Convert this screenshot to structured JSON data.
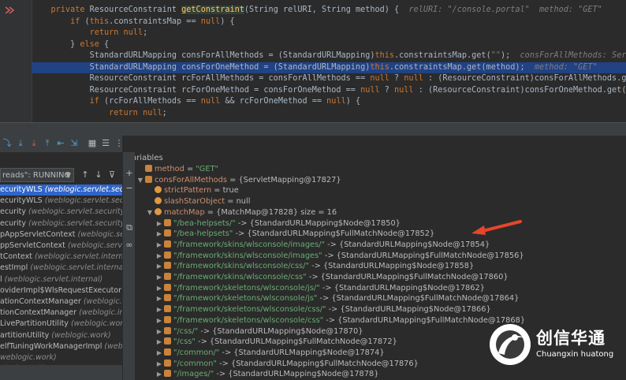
{
  "editor": {
    "lines": [
      {
        "parts": [
          {
            "t": "    private ",
            "c": "k"
          },
          {
            "t": "ResourceConstraint ",
            "c": ""
          },
          {
            "t": "getConstraint",
            "c": "f hl"
          },
          {
            "t": "(String relURI, String method) {  ",
            "c": ""
          },
          {
            "t": "relURI: \"/console.portal\"  method: \"GET\"",
            "c": "hint"
          }
        ]
      },
      {
        "parts": [
          {
            "t": "        ",
            "c": ""
          },
          {
            "t": "if ",
            "c": "k"
          },
          {
            "t": "(",
            "c": ""
          },
          {
            "t": "this",
            "c": "k"
          },
          {
            "t": ".constraintsMap == ",
            "c": ""
          },
          {
            "t": "null",
            "c": "k"
          },
          {
            "t": ") {",
            "c": ""
          }
        ]
      },
      {
        "parts": [
          {
            "t": "            ",
            "c": ""
          },
          {
            "t": "return null",
            "c": "k"
          },
          {
            "t": ";",
            "c": ""
          }
        ]
      },
      {
        "parts": [
          {
            "t": "        } ",
            "c": ""
          },
          {
            "t": "else ",
            "c": "k"
          },
          {
            "t": "{",
            "c": ""
          }
        ]
      },
      {
        "parts": [
          {
            "t": "            StandardURLMapping consForAllMethods = (StandardURLMapping)",
            "c": ""
          },
          {
            "t": "this",
            "c": "k"
          },
          {
            "t": ".constraintsMap.get(",
            "c": ""
          },
          {
            "t": "\"\"",
            "c": "s"
          },
          {
            "t": ");  ",
            "c": ""
          },
          {
            "t": "consForAllMethods: ServletMapping@17827",
            "c": "hint"
          }
        ]
      },
      {
        "parts": [
          {
            "t": "            StandardURLMapping consForOneMethod = (StandardURLMapping)",
            "c": ""
          },
          {
            "t": "this",
            "c": "k"
          },
          {
            "t": ".constraintsMap.get(method);  ",
            "c": ""
          },
          {
            "t": "method: \"GET\"",
            "c": "hint"
          }
        ],
        "selected": true
      },
      {
        "parts": [
          {
            "t": "            ResourceConstraint rcForAllMethods = consForAllMethods == ",
            "c": ""
          },
          {
            "t": "null",
            "c": "k"
          },
          {
            "t": " ? ",
            "c": ""
          },
          {
            "t": "null",
            "c": "k"
          },
          {
            "t": " : (ResourceConstraint)consForAllMethods.get(relURI);",
            "c": ""
          }
        ]
      },
      {
        "parts": [
          {
            "t": "            ResourceConstraint rcForOneMethod = consForOneMethod == ",
            "c": ""
          },
          {
            "t": "null",
            "c": "k"
          },
          {
            "t": " ? ",
            "c": ""
          },
          {
            "t": "null",
            "c": "k"
          },
          {
            "t": " : (ResourceConstraint)consForOneMethod.get(relURI);",
            "c": ""
          }
        ]
      },
      {
        "parts": [
          {
            "t": "            ",
            "c": ""
          },
          {
            "t": "if ",
            "c": "k"
          },
          {
            "t": "(rcForAllMethods == ",
            "c": ""
          },
          {
            "t": "null",
            "c": "k"
          },
          {
            "t": " && rcForOneMethod == ",
            "c": ""
          },
          {
            "t": "null",
            "c": "k"
          },
          {
            "t": ") {",
            "c": ""
          }
        ]
      },
      {
        "parts": [
          {
            "t": "                ",
            "c": ""
          },
          {
            "t": "return null",
            "c": "k"
          },
          {
            "t": ";",
            "c": ""
          }
        ]
      }
    ]
  },
  "toolbar": {
    "icons": [
      "step-over-icon",
      "step-into-icon",
      "force-step-into-icon",
      "step-out-icon",
      "drop-frame-icon",
      "run-to-cursor-icon",
      "evaluate-icon",
      "table-view-icon",
      "settings-icon"
    ],
    "glyphs": [
      "⤵",
      "⤓",
      "⤓",
      "⤒",
      "⇤",
      "⇲",
      "▦",
      "☰",
      "⋮"
    ]
  },
  "frames": {
    "thread_label": "reads\": RUNNING",
    "items": [
      {
        "method": "ecurityWLS ",
        "cls": "(weblogic.servlet.secur",
        "selected": true
      },
      {
        "method": "ecurityWLS ",
        "cls": "(weblogic.servlet.security.i",
        "selected": false
      },
      {
        "method": "ecurity ",
        "cls": "(weblogic.servlet.security.internal)",
        "selected": false
      },
      {
        "method": "ecurity ",
        "cls": "(weblogic.servlet.security.int",
        "selected": false
      },
      {
        "method": "pAppServletContext ",
        "cls": "(weblogic.servlet.i",
        "selected": false
      },
      {
        "method": "ppServletContext ",
        "cls": "(weblogic.servlet.int",
        "selected": false
      },
      {
        "method": "tContext ",
        "cls": "(weblogic.servlet.internal.",
        "selected": false
      },
      {
        "method": "estImpl ",
        "cls": "(weblogic.servlet.internal",
        "selected": false
      },
      {
        "method": "l ",
        "cls": "(weblogic.servlet.internal)",
        "selected": false
      },
      {
        "method": "oviderImpl$WlsRequestExecutor ",
        "cls": "(we",
        "selected": false
      },
      {
        "method": "ationContextManager ",
        "cls": "(weblogic.invo",
        "selected": false
      },
      {
        "method": "tionContextManager ",
        "cls": "(weblogic.invo",
        "selected": false
      },
      {
        "method": "LivePartitionUtility ",
        "cls": "(weblogic.work)",
        "selected": false
      },
      {
        "method": "artitionUtility ",
        "cls": "(weblogic.work)",
        "selected": false
      },
      {
        "method": "elfTuningWorkManagerImpl ",
        "cls": "(weblog",
        "selected": false
      },
      {
        "method": "",
        "cls": "weblogic.work)",
        "selected": false
      },
      {
        "method": "",
        "cls": "ologic.work)",
        "selected": false
      }
    ]
  },
  "variables": {
    "title": "Variables",
    "rows": [
      {
        "indent": 0,
        "tri": "",
        "icon": "ln",
        "name": "method",
        "eq": " = ",
        "val": "\"GET\"",
        "vc": "vstr",
        "meta": ""
      },
      {
        "indent": 0,
        "tri": "▼",
        "icon": "ln",
        "name": "consForAllMethods",
        "eq": " = ",
        "val": "{ServletMapping@17827}",
        "vc": "vobj",
        "meta": ""
      },
      {
        "indent": 1,
        "tri": "",
        "icon": "fo",
        "name": "strictPattern",
        "eq": " = ",
        "val": "true",
        "vc": "vobj",
        "meta": ""
      },
      {
        "indent": 1,
        "tri": "",
        "icon": "fo",
        "name": "slashStarObject",
        "eq": " = ",
        "val": "null",
        "vc": "vobj",
        "meta": ""
      },
      {
        "indent": 1,
        "tri": "▼",
        "icon": "fo",
        "name": "matchMap",
        "eq": " = ",
        "val": "{MatchMap@17828}",
        "vc": "vobj",
        "meta": "  size = 16"
      },
      {
        "indent": 2,
        "tri": "▶",
        "icon": "ln",
        "name": "",
        "eq": "",
        "val": "\"/bea-helpsets/\"",
        "vc": "vstr",
        "meta": " -> {StandardURLMapping$Node@17850}"
      },
      {
        "indent": 2,
        "tri": "▶",
        "icon": "ln",
        "name": "",
        "eq": "",
        "val": "\"/bea-helpsets\"",
        "vc": "vstr",
        "meta": " -> {StandardURLMapping$FullMatchNode@17852}"
      },
      {
        "indent": 2,
        "tri": "▶",
        "icon": "ln",
        "name": "",
        "eq": "",
        "val": "\"/framework/skins/wlsconsole/images/\"",
        "vc": "vstr",
        "meta": " -> {StandardURLMapping$Node@17854}"
      },
      {
        "indent": 2,
        "tri": "▶",
        "icon": "ln",
        "name": "",
        "eq": "",
        "val": "\"/framework/skins/wlsconsole/images\"",
        "vc": "vstr",
        "meta": " -> {StandardURLMapping$FullMatchNode@17856}"
      },
      {
        "indent": 2,
        "tri": "▶",
        "icon": "ln",
        "name": "",
        "eq": "",
        "val": "\"/framework/skins/wlsconsole/css/\"",
        "vc": "vstr",
        "meta": " -> {StandardURLMapping$Node@17858}"
      },
      {
        "indent": 2,
        "tri": "▶",
        "icon": "ln",
        "name": "",
        "eq": "",
        "val": "\"/framework/skins/wlsconsole/css\"",
        "vc": "vstr",
        "meta": " -> {StandardURLMapping$FullMatchNode@17860}"
      },
      {
        "indent": 2,
        "tri": "▶",
        "icon": "ln",
        "name": "",
        "eq": "",
        "val": "\"/framework/skeletons/wlsconsole/js/\"",
        "vc": "vstr",
        "meta": " -> {StandardURLMapping$Node@17862}"
      },
      {
        "indent": 2,
        "tri": "▶",
        "icon": "ln",
        "name": "",
        "eq": "",
        "val": "\"/framework/skeletons/wlsconsole/js\"",
        "vc": "vstr",
        "meta": " -> {StandardURLMapping$FullMatchNode@17864}"
      },
      {
        "indent": 2,
        "tri": "▶",
        "icon": "ln",
        "name": "",
        "eq": "",
        "val": "\"/framework/skeletons/wlsconsole/css/\"",
        "vc": "vstr",
        "meta": " -> {StandardURLMapping$Node@17866}"
      },
      {
        "indent": 2,
        "tri": "▶",
        "icon": "ln",
        "name": "",
        "eq": "",
        "val": "\"/framework/skeletons/wlsconsole/css\"",
        "vc": "vstr",
        "meta": " -> {StandardURLMapping$FullMatchNode@17868}"
      },
      {
        "indent": 2,
        "tri": "▶",
        "icon": "ln",
        "name": "",
        "eq": "",
        "val": "\"/css/\"",
        "vc": "vstr",
        "meta": " -> {StandardURLMapping$Node@17870}"
      },
      {
        "indent": 2,
        "tri": "▶",
        "icon": "ln",
        "name": "",
        "eq": "",
        "val": "\"/css\"",
        "vc": "vstr",
        "meta": " -> {StandardURLMapping$FullMatchNode@17872}"
      },
      {
        "indent": 2,
        "tri": "▶",
        "icon": "ln",
        "name": "",
        "eq": "",
        "val": "\"/common/\"",
        "vc": "vstr",
        "meta": " -> {StandardURLMapping$Node@17874}"
      },
      {
        "indent": 2,
        "tri": "▶",
        "icon": "ln",
        "name": "",
        "eq": "",
        "val": "\"/common\"",
        "vc": "vstr",
        "meta": " -> {StandardURLMapping$FullMatchNode@17876}"
      },
      {
        "indent": 2,
        "tri": "▶",
        "icon": "ln",
        "name": "",
        "eq": "",
        "val": "\"/images/\"",
        "vc": "vstr",
        "meta": " -> {StandardURLMapping$Node@17878}"
      }
    ]
  },
  "logo": {
    "cn": "创信华通",
    "en": "Chuangxin huatong"
  },
  "colors": {
    "annotation_arrow": "#e8452c",
    "selection": "#214283",
    "frame_selection": "#2f65ca"
  }
}
